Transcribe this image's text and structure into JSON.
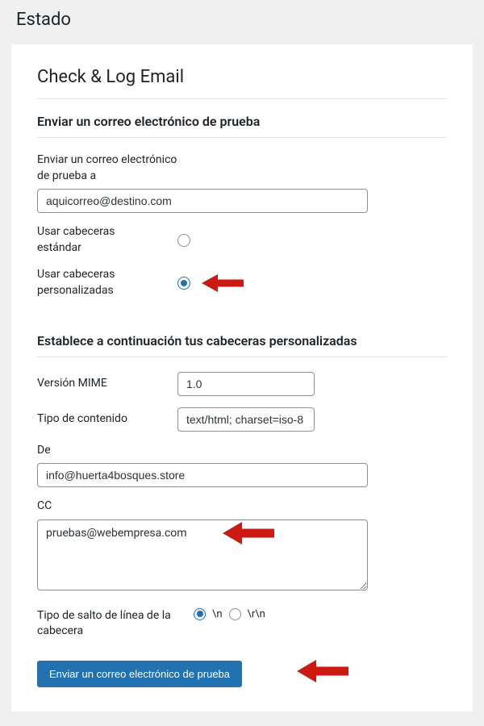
{
  "page": {
    "title": "Estado"
  },
  "card": {
    "title": "Check & Log Email",
    "section1": {
      "title": "Enviar un correo electrónico de prueba",
      "to_label": "Enviar un correo electrónico de prueba a",
      "to_value": "aquicorreo@destino.com",
      "std_headers_label": "Usar cabeceras estándar",
      "custom_headers_label": "Usar cabeceras personalizadas"
    },
    "section2": {
      "title": "Establece a continuación tus cabeceras personalizadas",
      "mime_label": "Versión MIME",
      "mime_value": "1.0",
      "ctype_label": "Tipo de contenido",
      "ctype_value": "text/html; charset=iso-8",
      "from_label": "De",
      "from_value": "info@huerta4bosques.store",
      "cc_label": "CC",
      "cc_value": "pruebas@webempresa.com",
      "break_label": "Tipo de salto de línea de la cabecera",
      "break_opt1": "\\n",
      "break_opt2": "\\r\\n",
      "submit_label": "Enviar un correo electrónico de prueba"
    }
  }
}
